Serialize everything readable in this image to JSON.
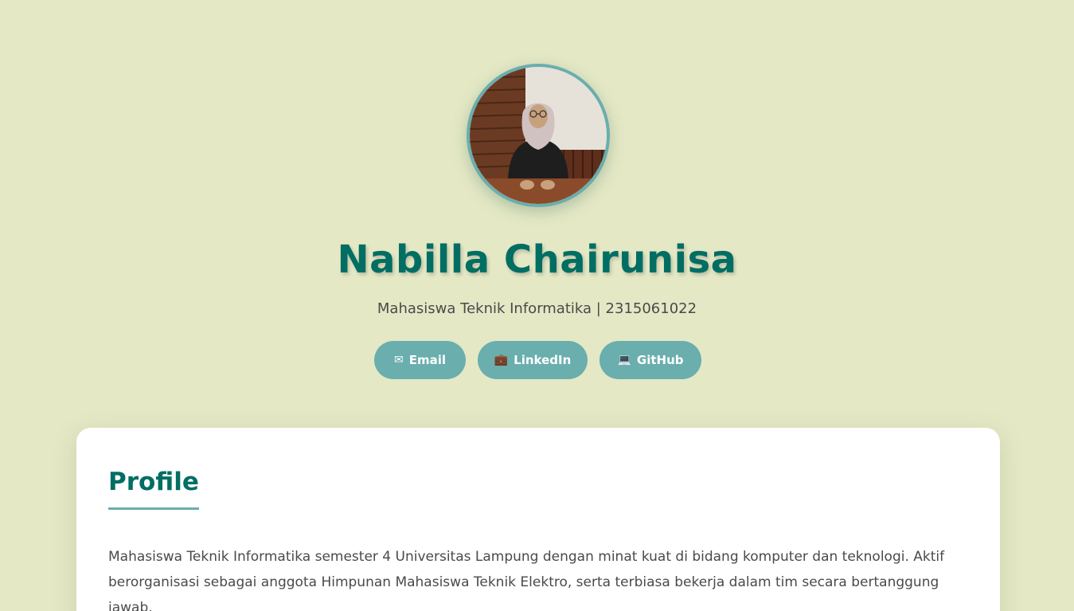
{
  "header": {
    "name": "Nabilla Chairunisa",
    "subtitle": "Mahasiswa Teknik Informatika | 2315061022",
    "avatar_alt": "Nabilla Chairunisa"
  },
  "social_links": [
    {
      "label": "Email",
      "icon": "envelope-icon",
      "glyph": "✉"
    },
    {
      "label": "LinkedIn",
      "icon": "briefcase-icon",
      "glyph": "💼"
    },
    {
      "label": "GitHub",
      "icon": "computer-icon",
      "glyph": "💻"
    }
  ],
  "profile": {
    "title": "Profile",
    "text": "Mahasiswa Teknik Informatika semester 4 Universitas Lampung dengan minat kuat di bidang komputer dan teknologi. Aktif berorganisasi sebagai anggota Himpunan Mahasiswa Teknik Elektro, serta terbiasa bekerja dalam tim secara bertanggung jawab."
  },
  "colors": {
    "background": "#e4e8c5",
    "accent": "#6aaeae",
    "heading": "#006e63",
    "card": "#ffffff"
  }
}
